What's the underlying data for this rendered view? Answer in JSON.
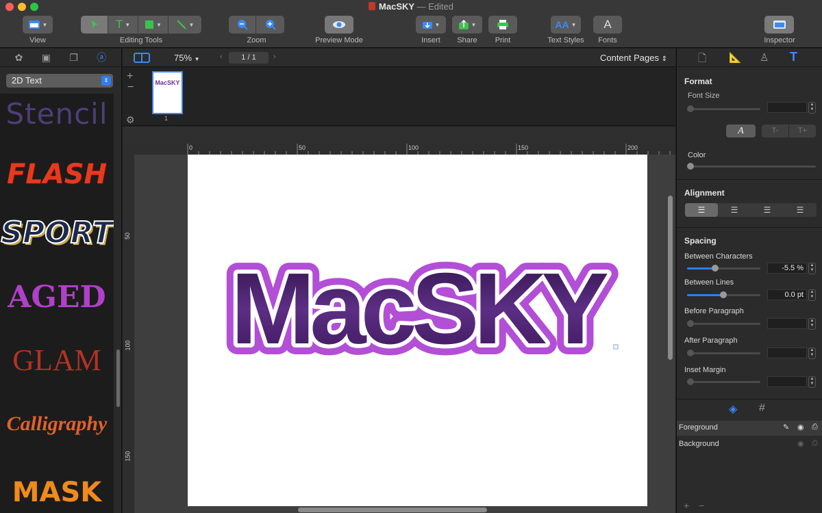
{
  "window": {
    "title": "MacSKY",
    "separator": "—",
    "status": "Edited"
  },
  "toolbar": {
    "view_label": "View",
    "editing_tools_label": "Editing Tools",
    "zoom_label": "Zoom",
    "preview_label": "Preview Mode",
    "insert_label": "Insert",
    "share_label": "Share",
    "print_label": "Print",
    "text_styles_label": "Text Styles",
    "fonts_label": "Fonts",
    "inspector_label": "Inspector"
  },
  "left_panel": {
    "style_category": "2D Text",
    "styles": [
      "Stencil",
      "FLASH",
      "SPORT",
      "AGED",
      "GLAM",
      "Calligraphy",
      "MASK"
    ]
  },
  "docbar": {
    "zoom": "75%",
    "page_indicator": "1 / 1",
    "content_pages": "Content Pages"
  },
  "thumbnail": {
    "text": "MacSKY",
    "page_number": "1"
  },
  "ruler": {
    "unit": "mm",
    "h_ticks": [
      "0",
      "50",
      "100",
      "150",
      "200"
    ],
    "v_ticks": [
      "50",
      "100",
      "150"
    ]
  },
  "canvas": {
    "main_text": "MacSKY"
  },
  "inspector": {
    "format_title": "Format",
    "font_size_label": "Font Size",
    "italic_glyph": "A",
    "smaller_glyph": "T-",
    "larger_glyph": "T+",
    "color_label": "Color",
    "alignment_title": "Alignment",
    "spacing_title": "Spacing",
    "between_characters_label": "Between Characters",
    "between_characters_value": "-5.5 %",
    "between_lines_label": "Between Lines",
    "between_lines_value": "0.0 pt",
    "before_paragraph_label": "Before Paragraph",
    "after_paragraph_label": "After Paragraph",
    "inset_margin_label": "Inset Margin",
    "layers": [
      "Foreground",
      "Background"
    ]
  },
  "colors": {
    "accent": "#2f7cf6",
    "text_purple": "#4a1f6e",
    "outline_purple": "#b24fd6"
  }
}
